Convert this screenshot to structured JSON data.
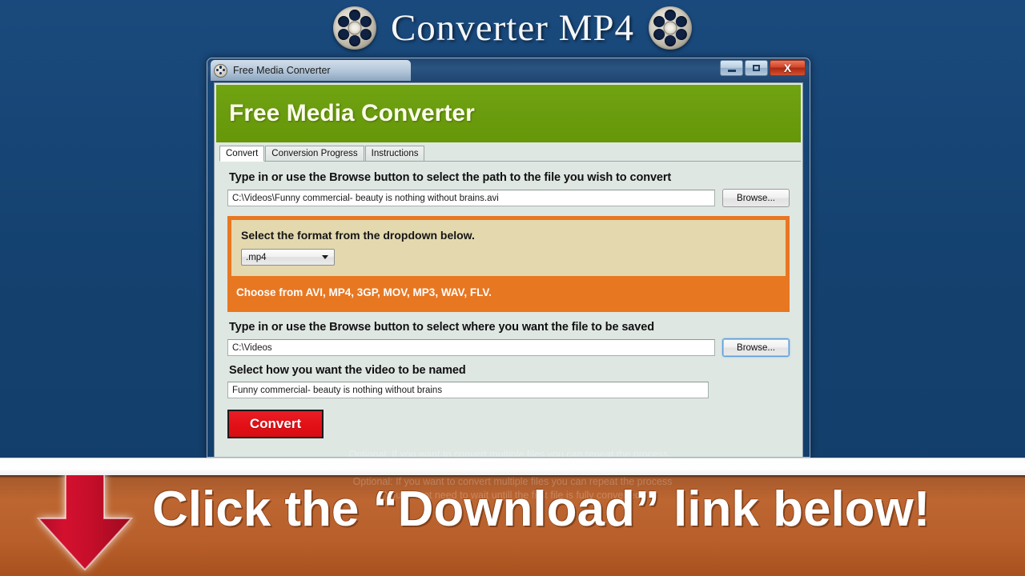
{
  "site": {
    "title": "Converter MP4",
    "left_icon": "film-reel-icon",
    "right_icon": "film-reel-icon",
    "background_color": "#14416f"
  },
  "window": {
    "title": "Free Media Converter",
    "icon": "film-reel-icon",
    "controls": {
      "minimize": "minimize-button",
      "maximize": "maximize-button",
      "close_glyph": "X"
    },
    "app_heading": "Free Media Converter",
    "heading_color": "#6a9c0f"
  },
  "tabs": [
    {
      "label": "Convert",
      "active": true
    },
    {
      "label": "Conversion Progress",
      "active": false
    },
    {
      "label": "Instructions",
      "active": false
    }
  ],
  "form": {
    "source_label": "Type in or use the Browse button to select the path to the file you wish to convert",
    "source_value": "C:\\Videos\\Funny commercial- beauty is nothing without brains.avi",
    "source_browse_label": "Browse...",
    "destination_label": "Type in or use the Browse button to select where you want the file to be saved",
    "destination_value": "C:\\Videos",
    "destination_browse_label": "Browse...",
    "naming_label": "Select how you want the video to be named",
    "naming_value": "Funny commercial- beauty is nothing without brains",
    "convert_label": "Convert",
    "convert_color": "#e31016"
  },
  "format_panel": {
    "title": "Select the format from the dropdown below.",
    "selected_format": ".mp4",
    "options": [
      ".avi",
      ".mp4",
      ".3gp",
      ".mov",
      ".mp3",
      ".wav",
      ".flv"
    ],
    "note": "Choose from AVI, MP4, 3GP, MOV, MP3, WAV, FLV.",
    "panel_color": "#e87722",
    "inner_color": "#e3d8ae"
  },
  "hints": {
    "line1": "Optional: If you want to convert multiple files you can repeat the process",
    "line2": "You do not need to wait untill the first file is fully converted"
  },
  "cta": {
    "text": "Click the “Download” link below!",
    "arrow_icon": "down-arrow-icon",
    "banner_color": "#b85f2b",
    "arrow_color": "#cc0f2e"
  }
}
